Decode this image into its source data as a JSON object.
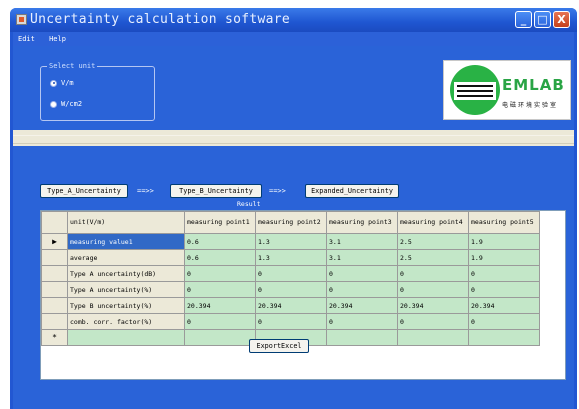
{
  "window": {
    "title": "Uncertainty calculation software",
    "controls": {
      "minimize": "_",
      "maximize": "□",
      "close": "X"
    }
  },
  "menu": [
    "Edit",
    "Help"
  ],
  "unit_select": {
    "legend": "Select unit",
    "options": [
      {
        "label": "V/m",
        "checked": true
      },
      {
        "label": "W/cm2",
        "checked": false
      }
    ]
  },
  "logo": {
    "text": "EMLAB",
    "subtitle": "电磁环境实验室"
  },
  "actions": {
    "type_a": "Type_A_Uncertainty",
    "arrow1": "==>>",
    "type_b": "Type_B_Uncertainty",
    "arrow2": "==>>",
    "expanded": "Expanded_Uncertainty",
    "export": "ExportExcel"
  },
  "result": {
    "label": "Result",
    "columns": [
      "unit(V/m)",
      "measuring point1",
      "measuring point2",
      "measuring point3",
      "measuring point4",
      "measuring point5"
    ],
    "rows": [
      {
        "marker": "▶",
        "name": "measuring value1",
        "values": [
          "0.6",
          "1.3",
          "3.1",
          "2.5",
          "1.9"
        ]
      },
      {
        "marker": "",
        "name": "average",
        "values": [
          "0.6",
          "1.3",
          "3.1",
          "2.5",
          "1.9"
        ]
      },
      {
        "marker": "",
        "name": "Type A uncertainty(dB)",
        "values": [
          "0",
          "0",
          "0",
          "0",
          "0"
        ]
      },
      {
        "marker": "",
        "name": "Type A uncertainty(%)",
        "values": [
          "0",
          "0",
          "0",
          "0",
          "0"
        ]
      },
      {
        "marker": "",
        "name": "Type B uncertainty(%)",
        "values": [
          "20.394",
          "20.394",
          "20.394",
          "20.394",
          "20.394"
        ]
      },
      {
        "marker": "",
        "name": "comb. corr. factor(%)",
        "values": [
          "0",
          "0",
          "0",
          "0",
          "0"
        ]
      }
    ],
    "new_row_marker": "*"
  },
  "colors": {
    "panel": "#2a63d8",
    "cell": "#c3e7c8",
    "selection": "#3169c6"
  }
}
